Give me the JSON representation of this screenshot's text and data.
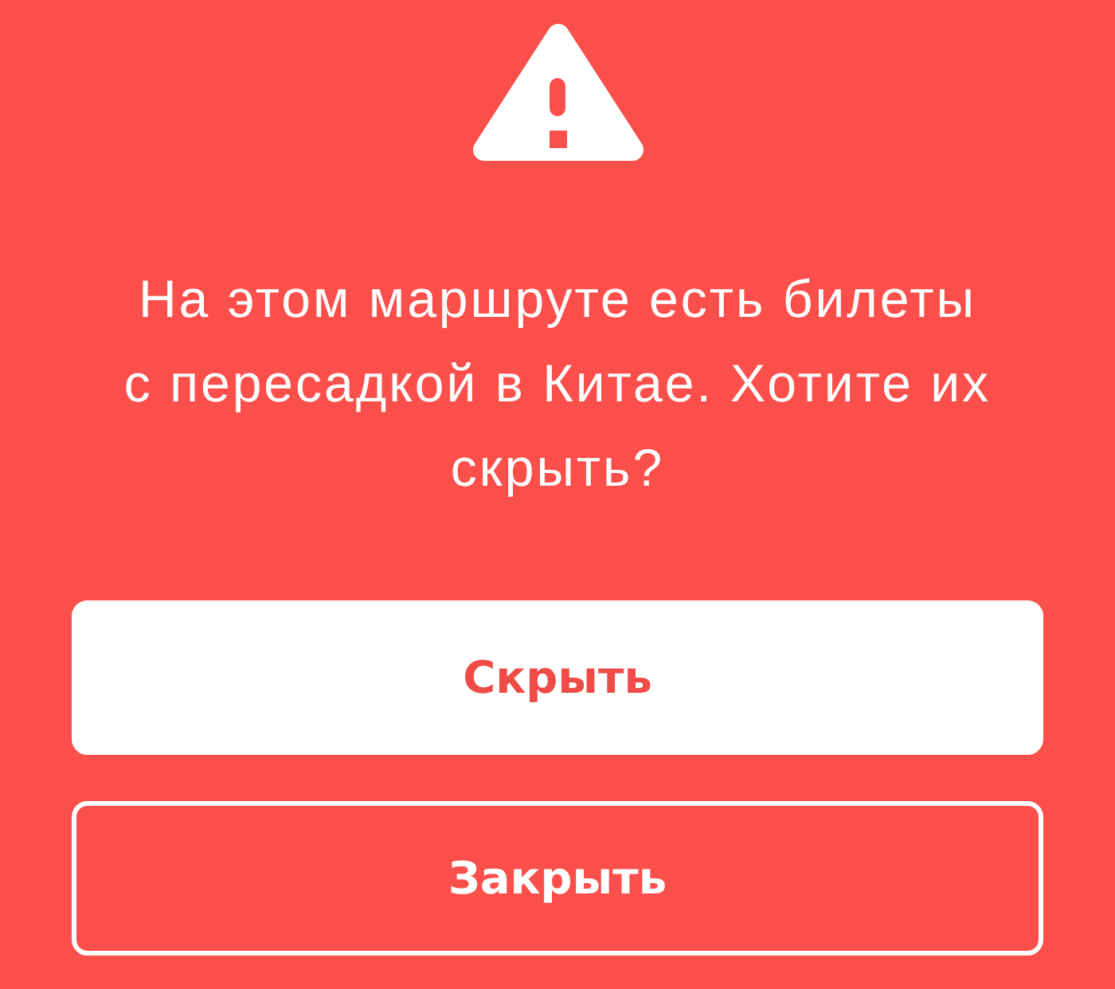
{
  "alert": {
    "message": "На этом маршруте есть билеты с пересадкой в Китае. Хотите их скрыть?"
  },
  "buttons": [
    {
      "kind": "filled",
      "label": "Скрыть"
    },
    {
      "kind": "outline",
      "label": "Закрыть"
    }
  ]
}
